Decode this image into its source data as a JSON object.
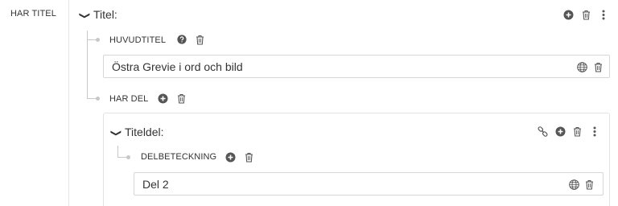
{
  "left_property": {
    "label": "HAR TITEL"
  },
  "title_entity": {
    "title": "Titel:",
    "icons": [
      "plus-circle-icon",
      "trash-icon",
      "kebab-menu-icon"
    ]
  },
  "huvudtitel": {
    "label": "HUVUDTITEL",
    "icons": [
      "help-circle-icon",
      "trash-icon"
    ],
    "value": "Östra Grevie i ord och bild",
    "value_icons": [
      "globe-icon",
      "trash-icon"
    ]
  },
  "har_del": {
    "label": "HAR DEL",
    "icons": [
      "plus-circle-icon",
      "trash-icon"
    ]
  },
  "titeldel": {
    "title": "Titeldel:",
    "icons": [
      "link-icon",
      "plus-circle-icon",
      "trash-icon",
      "kebab-menu-icon"
    ],
    "delbeteckning": {
      "label": "DELBETECKNING",
      "icons": [
        "plus-circle-icon",
        "trash-icon"
      ],
      "value": "Del 2",
      "value_icons": [
        "globe-icon",
        "trash-icon"
      ]
    }
  },
  "colors": {
    "icon": "#555555",
    "line": "#c8c8c8",
    "border": "#d6d6d6"
  }
}
